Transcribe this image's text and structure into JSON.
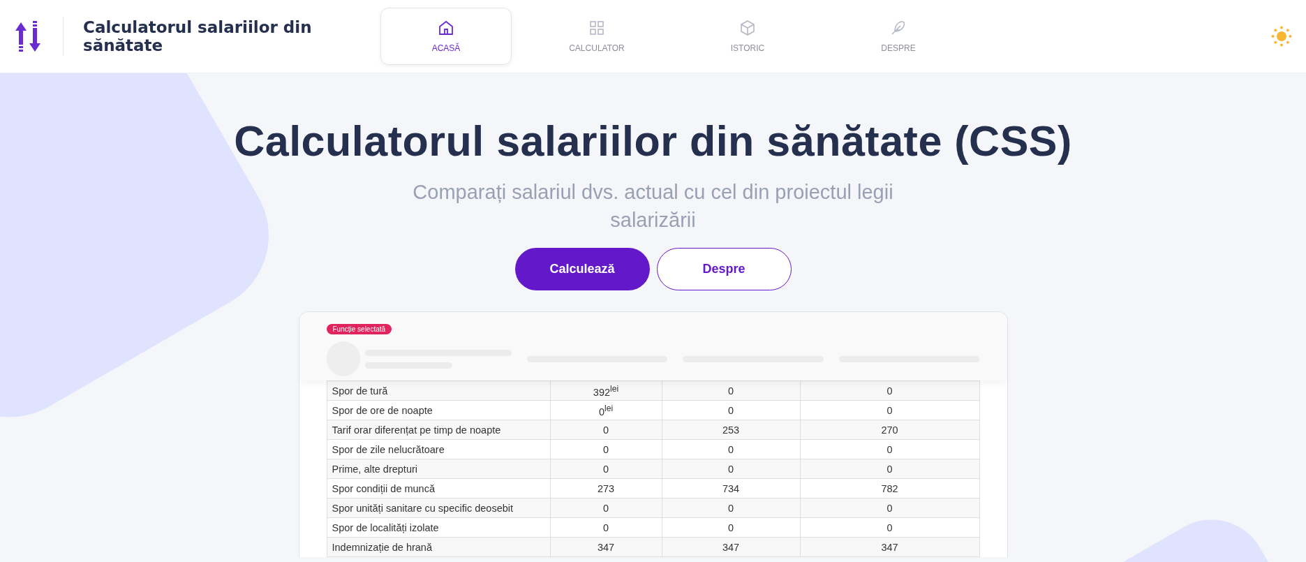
{
  "header": {
    "title": "Calculatorul salariilor din sănătate"
  },
  "nav": [
    {
      "label": "ACASĂ",
      "selected": true
    },
    {
      "label": "CALCULATOR",
      "selected": false
    },
    {
      "label": "ISTORIC",
      "selected": false
    },
    {
      "label": "DESPRE",
      "selected": false
    }
  ],
  "hero": {
    "title": "Calculatorul salariilor din sănătate (CSS)",
    "subtitle": "Comparați salariul dvs. actual cu cel din proiectul legii salarizării",
    "buttons": [
      {
        "label": "Calculează",
        "kind": "primary"
      },
      {
        "label": "Despre",
        "kind": "outline"
      }
    ]
  },
  "preview": {
    "badge": "Funcție selectată",
    "rows": [
      {
        "label": "Spor de tură",
        "cells": [
          "392$^{lei}$",
          "0",
          "0"
        ]
      },
      {
        "label": "Spor de ore de noapte",
        "cells": [
          "0$^{lei}$",
          "0",
          "0"
        ]
      },
      {
        "label": "Tarif orar diferențat pe timp de noapte",
        "cells": [
          "0",
          "253",
          "270"
        ]
      },
      {
        "label": "Spor de zile nelucrătoare",
        "cells": [
          "0",
          "0",
          "0"
        ]
      },
      {
        "label": "Prime, alte drepturi",
        "cells": [
          "0",
          "0",
          "0"
        ]
      },
      {
        "label": "Spor condiții de muncă",
        "cells": [
          "273",
          "734",
          "782"
        ]
      },
      {
        "label": "Spor unități sanitare cu specific deosebit",
        "cells": [
          "0",
          "0",
          "0"
        ]
      },
      {
        "label": "Spor de localități izolate",
        "cells": [
          "0",
          "0",
          "0"
        ]
      },
      {
        "label": "Indemnizație de hrană",
        "cells": [
          "347",
          "347",
          "347"
        ]
      }
    ]
  }
}
